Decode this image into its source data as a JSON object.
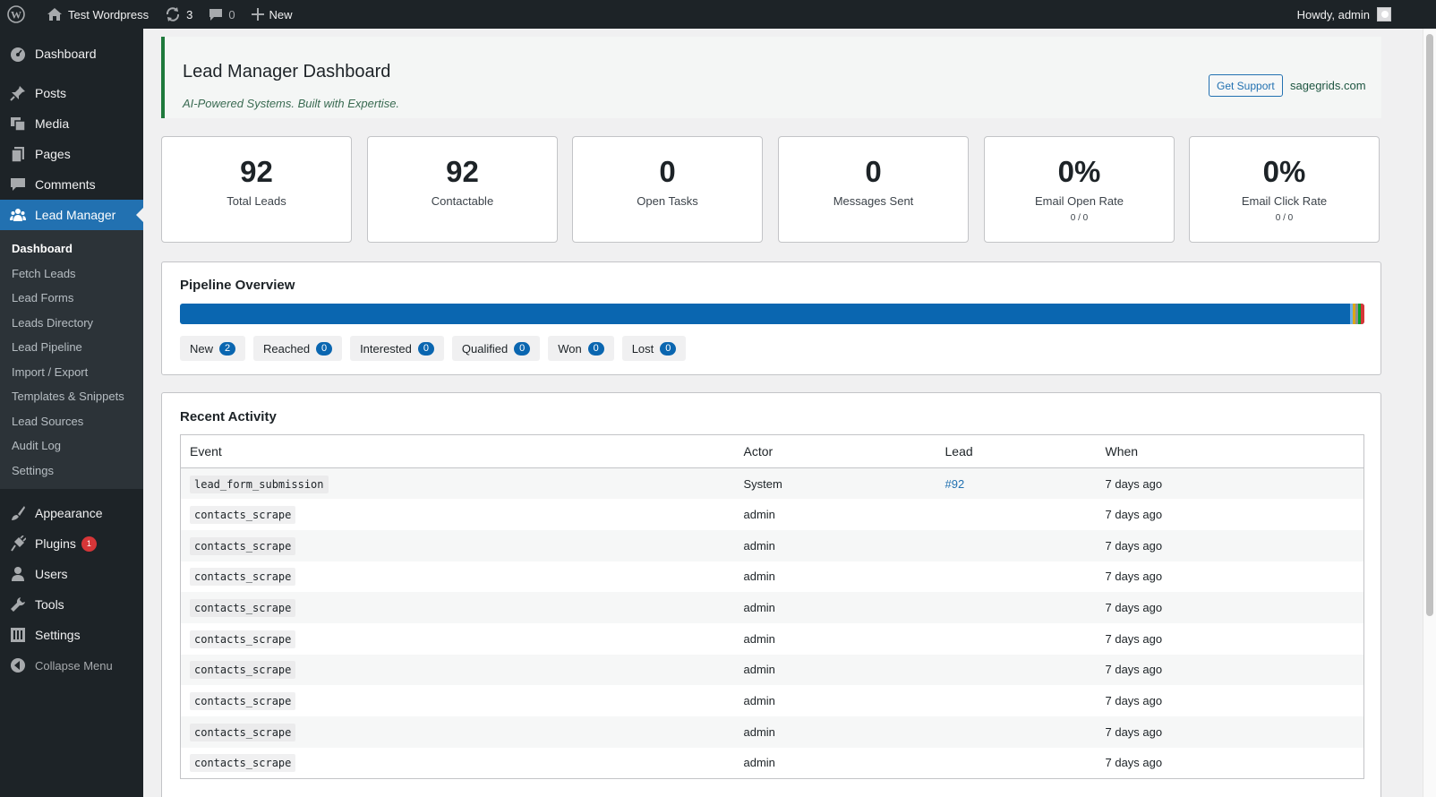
{
  "adminbar": {
    "site_name": "Test Wordpress",
    "updates_count": "3",
    "comments_count": "0",
    "new_label": "New",
    "howdy": "Howdy, admin"
  },
  "sidebar": {
    "top_items": [
      {
        "label": "Dashboard",
        "icon": "dashboard-icon"
      },
      {
        "label": "Posts",
        "icon": "pin-icon"
      },
      {
        "label": "Media",
        "icon": "media-icon"
      },
      {
        "label": "Pages",
        "icon": "pages-icon"
      },
      {
        "label": "Comments",
        "icon": "comments-icon"
      },
      {
        "label": "Lead Manager",
        "icon": "groups-icon"
      }
    ],
    "submenu": [
      "Dashboard",
      "Fetch Leads",
      "Lead Forms",
      "Leads Directory",
      "Lead Pipeline",
      "Import / Export",
      "Templates & Snippets",
      "Lead Sources",
      "Audit Log",
      "Settings"
    ],
    "bottom_items": [
      {
        "label": "Appearance",
        "icon": "brush-icon"
      },
      {
        "label": "Plugins",
        "icon": "plugin-icon",
        "badge": "1"
      },
      {
        "label": "Users",
        "icon": "users-icon"
      },
      {
        "label": "Tools",
        "icon": "wrench-icon"
      },
      {
        "label": "Settings",
        "icon": "settings-icon"
      }
    ],
    "collapse_label": "Collapse Menu"
  },
  "header": {
    "title": "Lead Manager Dashboard",
    "tagline": "AI-Powered Systems. Built with Expertise.",
    "support_button": "Get Support",
    "site_link": "sagegrids.com"
  },
  "stats": [
    {
      "value": "92",
      "label": "Total Leads"
    },
    {
      "value": "92",
      "label": "Contactable"
    },
    {
      "value": "0",
      "label": "Open Tasks"
    },
    {
      "value": "0",
      "label": "Messages Sent"
    },
    {
      "value": "0%",
      "label": "Email Open Rate",
      "sub": "0 / 0"
    },
    {
      "value": "0%",
      "label": "Email Click Rate",
      "sub": "0 / 0"
    }
  ],
  "pipeline": {
    "title": "Pipeline Overview",
    "stages": [
      {
        "label": "New",
        "count": "2"
      },
      {
        "label": "Reached",
        "count": "0"
      },
      {
        "label": "Interested",
        "count": "0"
      },
      {
        "label": "Qualified",
        "count": "0"
      },
      {
        "label": "Won",
        "count": "0"
      },
      {
        "label": "Lost",
        "count": "0"
      }
    ],
    "colors": {
      "new": "#0a66b0",
      "accent_bar": "#2271b1"
    }
  },
  "activity": {
    "title": "Recent Activity",
    "columns": [
      "Event",
      "Actor",
      "Lead",
      "When"
    ],
    "rows": [
      {
        "event": "lead_form_submission",
        "actor": "System",
        "lead": "#92",
        "when": "7 days ago"
      },
      {
        "event": "contacts_scrape",
        "actor": "admin",
        "lead": "",
        "when": "7 days ago"
      },
      {
        "event": "contacts_scrape",
        "actor": "admin",
        "lead": "",
        "when": "7 days ago"
      },
      {
        "event": "contacts_scrape",
        "actor": "admin",
        "lead": "",
        "when": "7 days ago"
      },
      {
        "event": "contacts_scrape",
        "actor": "admin",
        "lead": "",
        "when": "7 days ago"
      },
      {
        "event": "contacts_scrape",
        "actor": "admin",
        "lead": "",
        "when": "7 days ago"
      },
      {
        "event": "contacts_scrape",
        "actor": "admin",
        "lead": "",
        "when": "7 days ago"
      },
      {
        "event": "contacts_scrape",
        "actor": "admin",
        "lead": "",
        "when": "7 days ago"
      },
      {
        "event": "contacts_scrape",
        "actor": "admin",
        "lead": "",
        "when": "7 days ago"
      },
      {
        "event": "contacts_scrape",
        "actor": "admin",
        "lead": "",
        "when": "7 days ago"
      }
    ]
  },
  "theme": {
    "admin_dark": "#1d2327",
    "primary": "#2271b1",
    "header_accent": "#1f7a3c"
  }
}
